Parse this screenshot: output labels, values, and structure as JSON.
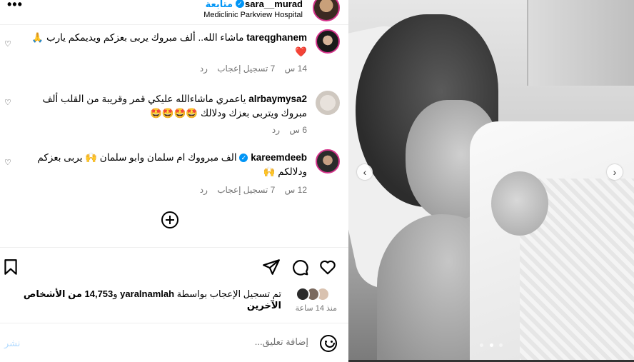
{
  "header": {
    "username": "sara__murad",
    "follow_label": "متابعة",
    "location": "Mediclinic Parkview Hospital",
    "more_label": "•••"
  },
  "comments": [
    {
      "user": "tareqghanem",
      "text": "ماشاء الله.. ألف مبروك يربى بعزكم ويديمكم يارب 🙏",
      "heart": "❤️",
      "time": "14 س",
      "likes": "7 تسجيل إعجاب",
      "reply": "رد"
    },
    {
      "user": "alrbaymysa2",
      "text": "ياعمري ماشاءالله عليكي قمر وقريبة من القلب ألف مبروك ويتربى بعزك ودلالك 🤩🤩🤩🤩",
      "time": "6 س",
      "reply": "رد"
    },
    {
      "user": "kareemdeeb",
      "text": "الف مبرووك ام سلمان وابو سلمان 🙌 يربى بعزكم ودلالكم 🙌",
      "time": "12 س",
      "likes": "7 تسجيل إعجاب",
      "reply": "رد"
    }
  ],
  "likes": {
    "prefix": "تم تسجيل الإعجاب بواسطة",
    "user": "yaralnamlah",
    "and": "و",
    "count": "14,753",
    "suffix": "من الأشخاص الآخرين"
  },
  "time_ago": "منذ 14 ساعة",
  "add_comment": {
    "placeholder": "إضافة تعليق...",
    "post_label": "نشر"
  },
  "carousel": {
    "prev": "‹",
    "next": "›",
    "slides": 3,
    "active": 2
  }
}
